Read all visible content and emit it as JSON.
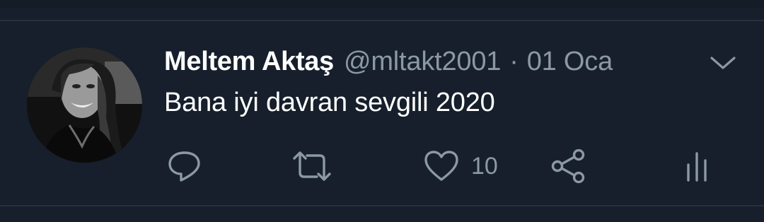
{
  "tweet": {
    "author_name": "Meltem Aktaş",
    "handle": "@mltakt2001",
    "separator": "·",
    "date": "01 Oca",
    "text": "Bana iyi davran sevgili 2020"
  },
  "actions": {
    "reply_icon": "reply-icon",
    "retweet_icon": "retweet-icon",
    "like_icon": "heart-icon",
    "like_count": "10",
    "share_icon": "share-icon",
    "analytics_icon": "analytics-icon"
  },
  "colors": {
    "background": "#161f2b",
    "divider": "#263140",
    "primary_text": "#ffffff",
    "secondary_text": "#8b98a5"
  }
}
